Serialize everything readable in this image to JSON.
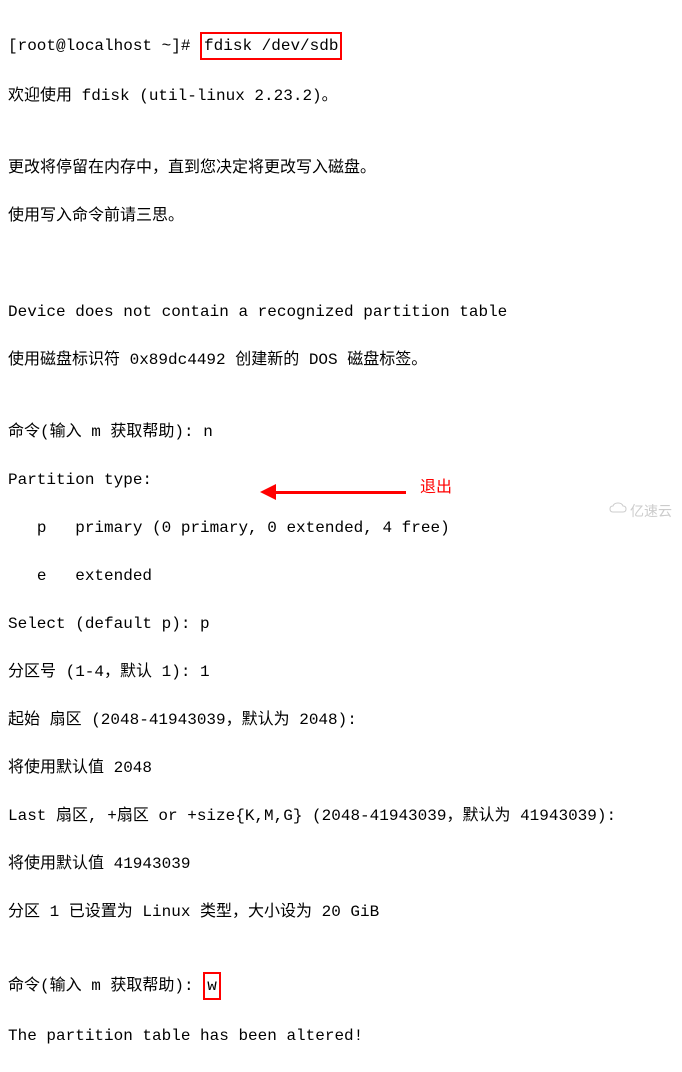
{
  "terminal": {
    "prompt": "[root@localhost ~]# ",
    "command": "fdisk /dev/sdb",
    "line1": "欢迎使用 fdisk (util-linux 2.23.2)。",
    "line2": "",
    "line3": "更改将停留在内存中，直到您决定将更改写入磁盘。",
    "line4": "使用写入命令前请三思。",
    "line5": "",
    "line6": "",
    "line7": "Device does not contain a recognized partition table",
    "line8": "使用磁盘标识符 0x89dc4492 创建新的 DOS 磁盘标签。",
    "line9": "",
    "line10": "命令(输入 m 获取帮助): n",
    "line11": "Partition type:",
    "line12": "   p   primary (0 primary, 0 extended, 4 free)",
    "line13": "   e   extended",
    "line14": "Select (default p): p",
    "line15": "分区号 (1-4，默认 1): 1",
    "line16": "起始 扇区 (2048-41943039，默认为 2048):",
    "line17": "将使用默认值 2048",
    "line18": "Last 扇区, +扇区 or +size{K,M,G} (2048-41943039，默认为 41943039):",
    "line19": "将使用默认值 41943039",
    "line20": "分区 1 已设置为 Linux 类型，大小设为 20 GiB",
    "line21": "",
    "line22_prefix": "命令(输入 m 获取帮助): ",
    "line22_input": "w",
    "line23": "The partition table has been altered!"
  },
  "annotation": {
    "exit_label": "退出"
  },
  "watermark": {
    "text": "亿速云"
  }
}
